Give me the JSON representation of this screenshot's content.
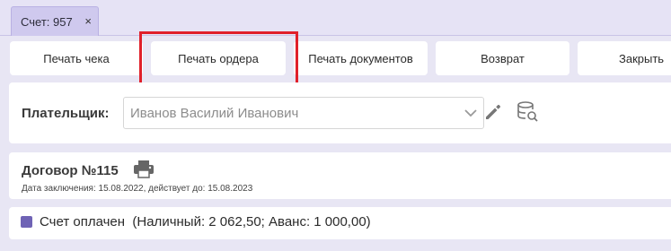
{
  "tabs": [
    {
      "label": "Счет: 957",
      "close_glyph": "×",
      "close_icon": "close-icon"
    }
  ],
  "toolbar": {
    "buttons": [
      {
        "label": "Печать чека"
      },
      {
        "label": "Печать ордера"
      },
      {
        "label": "Печать документов"
      },
      {
        "label": "Возврат"
      },
      {
        "label": "Закрыть"
      }
    ],
    "highlighted_button": "Печать ордера",
    "highlight_color": "#e0202a"
  },
  "payer": {
    "label": "Плательщик:",
    "selected_value": "Иванов Василий Иванович",
    "icons": [
      "chevron-down-icon",
      "pencil-icon",
      "database-search-icon"
    ]
  },
  "contract": {
    "title": "Договор №115",
    "subtitle": "Дата заключения: 15.08.2022, действует до: 15.08.2023",
    "icon": "printer-icon"
  },
  "payment": {
    "status_label": "Счет оплачен",
    "details": "(Наличный: 2 062,50; Аванс: 1 000,00)",
    "checked": true,
    "accent_color": "#6f63b5"
  }
}
